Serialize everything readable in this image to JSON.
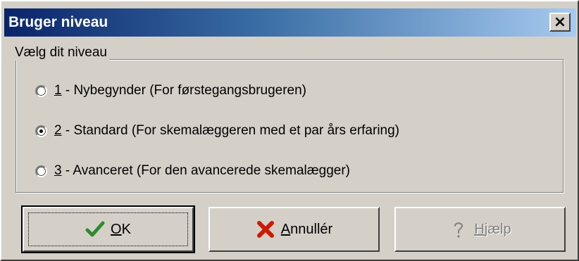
{
  "window": {
    "title": "Bruger niveau",
    "close_label": "×"
  },
  "group": {
    "label": "Vælg dit niveau",
    "options": [
      {
        "accel": "1",
        "text": " - Nybegynder (For førstegangsbrugeren)",
        "checked": false
      },
      {
        "accel": "2",
        "text": " - Standard (For skemalæggeren med et par års erfaring)",
        "checked": true
      },
      {
        "accel": "3",
        "text": " - Avanceret (For den avancerede skemalægger)",
        "checked": false
      }
    ]
  },
  "buttons": {
    "ok": {
      "accel": "O",
      "rest": "K",
      "icon": "checkmark-icon",
      "icon_color": "#2e8b2e"
    },
    "cancel": {
      "accel": "A",
      "rest": "nnullér",
      "icon": "x-icon",
      "icon_color": "#cc1a00"
    },
    "help": {
      "accel": "H",
      "rest": "jælp",
      "icon": "question-icon",
      "disabled": true
    }
  }
}
